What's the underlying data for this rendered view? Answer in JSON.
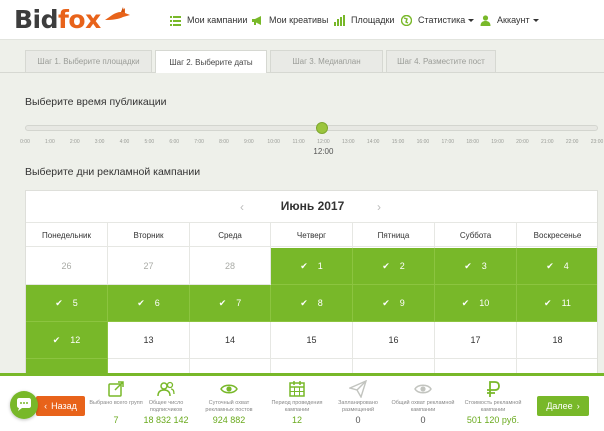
{
  "header": {
    "logo": {
      "part1": "Bid",
      "part2": "fox"
    },
    "nav": [
      {
        "label": "Мои кампании",
        "icon": "list-icon"
      },
      {
        "label": "Мои креативы",
        "icon": "megaphone-icon"
      },
      {
        "label": "Площадки",
        "icon": "bar-chart-icon"
      },
      {
        "label": "Статистика",
        "icon": "globe-icon",
        "dropdown": true
      },
      {
        "label": "Аккаунт",
        "icon": "user-icon",
        "dropdown": true
      }
    ]
  },
  "steps": [
    {
      "label": "Шаг 1. Выберите площадки",
      "active": false
    },
    {
      "label": "Шаг 2. Выберите даты",
      "active": true
    },
    {
      "label": "Шаг 3. Медиаплан",
      "active": false
    },
    {
      "label": "Шаг 4. Разместите пост",
      "active": false
    }
  ],
  "time_section": {
    "title": "Выберите время публикации",
    "ticks": [
      "0:00",
      "1:00",
      "2:00",
      "3:00",
      "4:00",
      "5:00",
      "6:00",
      "7:00",
      "8:00",
      "9:00",
      "10:00",
      "11:00",
      "12:00",
      "13:00",
      "14:00",
      "15:00",
      "16:00",
      "17:00",
      "18:00",
      "19:00",
      "20:00",
      "21:00",
      "22:00",
      "23:00"
    ],
    "selected_value": "12:00",
    "selected_index": 12
  },
  "days_section": {
    "title": "Выберите дни рекламной кампании",
    "month": "Июнь 2017",
    "weekdays": [
      "Понедельник",
      "Вторник",
      "Среда",
      "Четверг",
      "Пятница",
      "Суббота",
      "Воскресенье"
    ],
    "rows": [
      [
        {
          "d": "26",
          "s": "muted"
        },
        {
          "d": "27",
          "s": "muted"
        },
        {
          "d": "28",
          "s": "muted"
        },
        {
          "d": "1",
          "s": "sel"
        },
        {
          "d": "2",
          "s": "sel"
        },
        {
          "d": "3",
          "s": "sel"
        },
        {
          "d": "4",
          "s": "sel"
        }
      ],
      [
        {
          "d": "5",
          "s": "sel"
        },
        {
          "d": "6",
          "s": "sel"
        },
        {
          "d": "7",
          "s": "sel"
        },
        {
          "d": "8",
          "s": "sel"
        },
        {
          "d": "9",
          "s": "sel"
        },
        {
          "d": "10",
          "s": "sel"
        },
        {
          "d": "11",
          "s": "sel"
        }
      ],
      [
        {
          "d": "12",
          "s": "sel"
        },
        {
          "d": "13",
          "s": "normal"
        },
        {
          "d": "14",
          "s": "normal"
        },
        {
          "d": "15",
          "s": "normal"
        },
        {
          "d": "16",
          "s": "normal"
        },
        {
          "d": "17",
          "s": "normal"
        },
        {
          "d": "18",
          "s": "normal"
        }
      ]
    ]
  },
  "bottom_bar": {
    "back_label": "Назад",
    "next_label": "Далее",
    "stats": [
      {
        "label": "Выбрано всего групп",
        "value": "7",
        "icon": "export-icon"
      },
      {
        "label": "Общее число подписчиков",
        "value": "18 832 142",
        "icon": "users-icon"
      },
      {
        "label": "Суточный охват рекламных постов",
        "value": "924 882",
        "icon": "eye-icon"
      },
      {
        "label": "Период проведения кампании",
        "value": "12",
        "icon": "calendar-icon"
      },
      {
        "label": "Запланировано размещений",
        "value": "0",
        "icon": "paper-plane-icon"
      },
      {
        "label": "Общий охват рекламной кампании",
        "value": "0",
        "icon": "eye-icon"
      },
      {
        "label": "Стоимость рекламной кампании",
        "value": "501 120 руб.",
        "icon": "ruble-icon"
      }
    ]
  },
  "colors": {
    "brand_green": "#78b829",
    "brand_orange": "#e8631a"
  }
}
